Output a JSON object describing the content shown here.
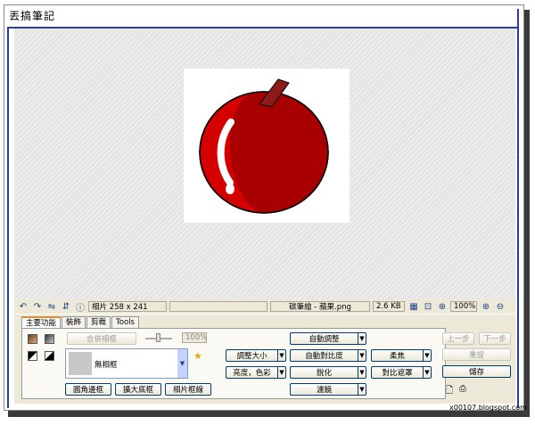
{
  "page_title": "丟搞筆記",
  "toolbar": {
    "photo_size": "相片 258 x 241",
    "file_name": "碳筆繪 - 蘋果.png",
    "file_size": "2.6 KB",
    "zoom": "100%"
  },
  "tabs": [
    "主要功能",
    "裝飾",
    "剪裁",
    "Tools"
  ],
  "frame_panel": {
    "merge_button": "合併相框",
    "opacity": "100%",
    "frame_select": "無相框",
    "round_corner_button": "圓角邊框",
    "enlarge_base_button": "擴大底框",
    "photo_frame_button": "相片框線"
  },
  "adjust": {
    "auto_adjust": "自動調整",
    "resize": "調整大小",
    "auto_contrast": "自動對比度",
    "soft_focus": "柔焦",
    "brightness_color": "亮度，色彩",
    "sharpen": "銳化",
    "contrast_mask": "對比遮罩",
    "filter": "濾鏡"
  },
  "actions": {
    "undo": "上一步",
    "redo": "下一步",
    "reset": "重設",
    "save": "儲存"
  },
  "credit": "x00107.blogspot.com",
  "colors": {
    "frame_border": "#2b3f8f",
    "apple_red": "#d00000",
    "apple_dark": "#a00000",
    "stem": "#8b1a1a"
  }
}
